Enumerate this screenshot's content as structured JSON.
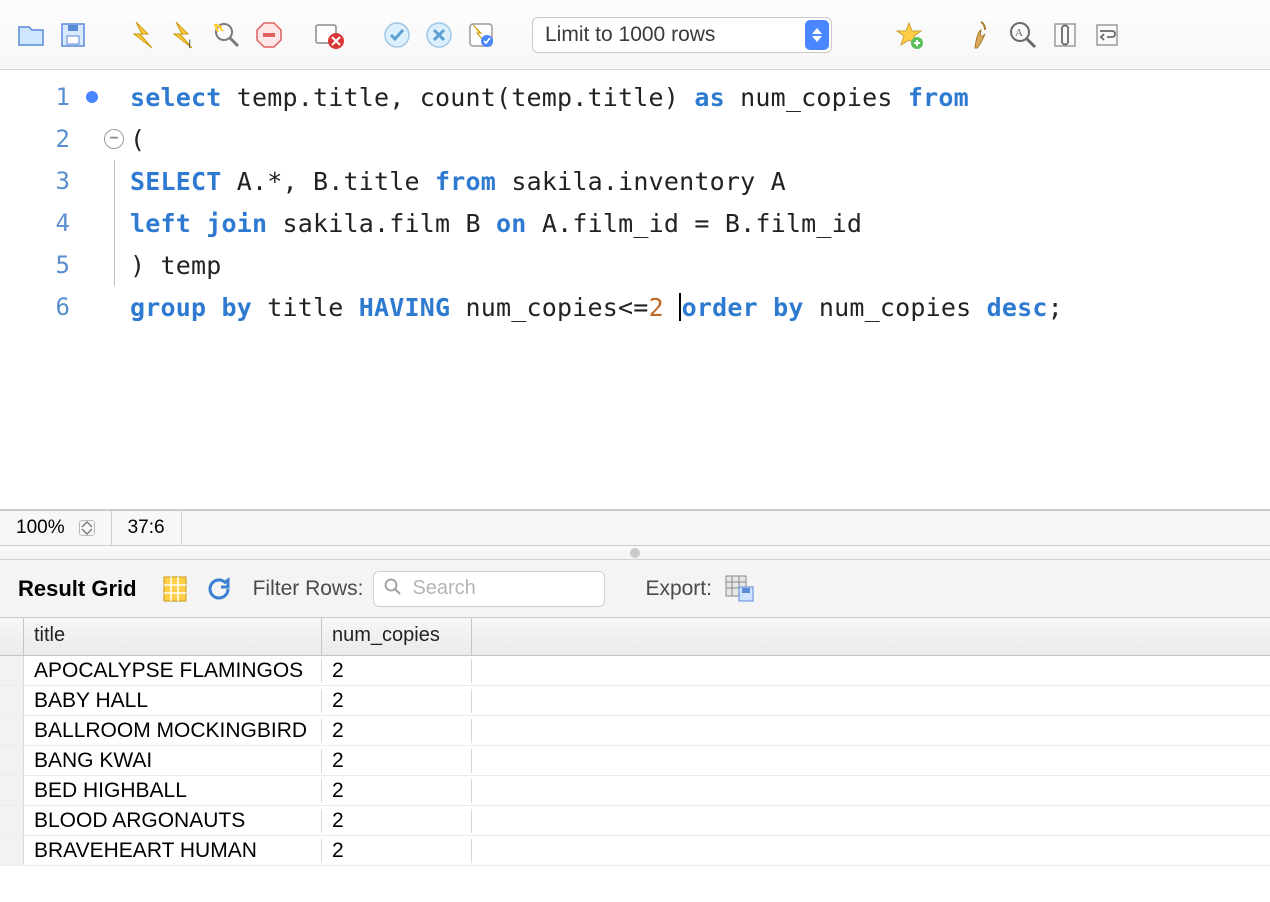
{
  "toolbar": {
    "limit_label": "Limit to 1000 rows"
  },
  "editor": {
    "lines": [
      [
        [
          "kw",
          "select "
        ],
        [
          "txt",
          "temp.title, count(temp.title) "
        ],
        [
          "kw",
          "as "
        ],
        [
          "txt",
          "num_copies "
        ],
        [
          "kw",
          "from"
        ]
      ],
      [
        [
          "txt",
          "("
        ]
      ],
      [
        [
          "kw2",
          "SELECT "
        ],
        [
          "txt",
          "A.*, B.title "
        ],
        [
          "kw",
          "from "
        ],
        [
          "txt",
          "sakila.inventory A"
        ]
      ],
      [
        [
          "kw",
          "left join "
        ],
        [
          "txt",
          "sakila.film B "
        ],
        [
          "kw",
          "on "
        ],
        [
          "txt",
          "A.film_id = B.film_id"
        ]
      ],
      [
        [
          "txt",
          ") temp"
        ]
      ],
      [
        [
          "kw",
          "group by "
        ],
        [
          "txt",
          "title "
        ],
        [
          "kw2",
          "HAVING "
        ],
        [
          "txt",
          "num_copies<="
        ],
        [
          "num",
          "2"
        ],
        [
          "txt",
          " "
        ],
        [
          "cursor",
          ""
        ],
        [
          "kw",
          "order by "
        ],
        [
          "txt",
          "num_copies "
        ],
        [
          "kw",
          "desc"
        ],
        [
          "txt",
          ";"
        ]
      ]
    ],
    "highlight_line_index": 5
  },
  "status": {
    "zoom": "100%",
    "position": "37:6"
  },
  "results": {
    "title": "Result Grid",
    "filter_label": "Filter Rows:",
    "filter_placeholder": "Search",
    "export_label": "Export:",
    "columns": [
      "title",
      "num_copies"
    ],
    "rows": [
      {
        "title": "APOCALYPSE FLAMINGOS",
        "num_copies": "2"
      },
      {
        "title": "BABY HALL",
        "num_copies": "2"
      },
      {
        "title": "BALLROOM MOCKINGBIRD",
        "num_copies": "2"
      },
      {
        "title": "BANG KWAI",
        "num_copies": "2"
      },
      {
        "title": "BED HIGHBALL",
        "num_copies": "2"
      },
      {
        "title": "BLOOD ARGONAUTS",
        "num_copies": "2"
      },
      {
        "title": "BRAVEHEART HUMAN",
        "num_copies": "2"
      }
    ]
  }
}
